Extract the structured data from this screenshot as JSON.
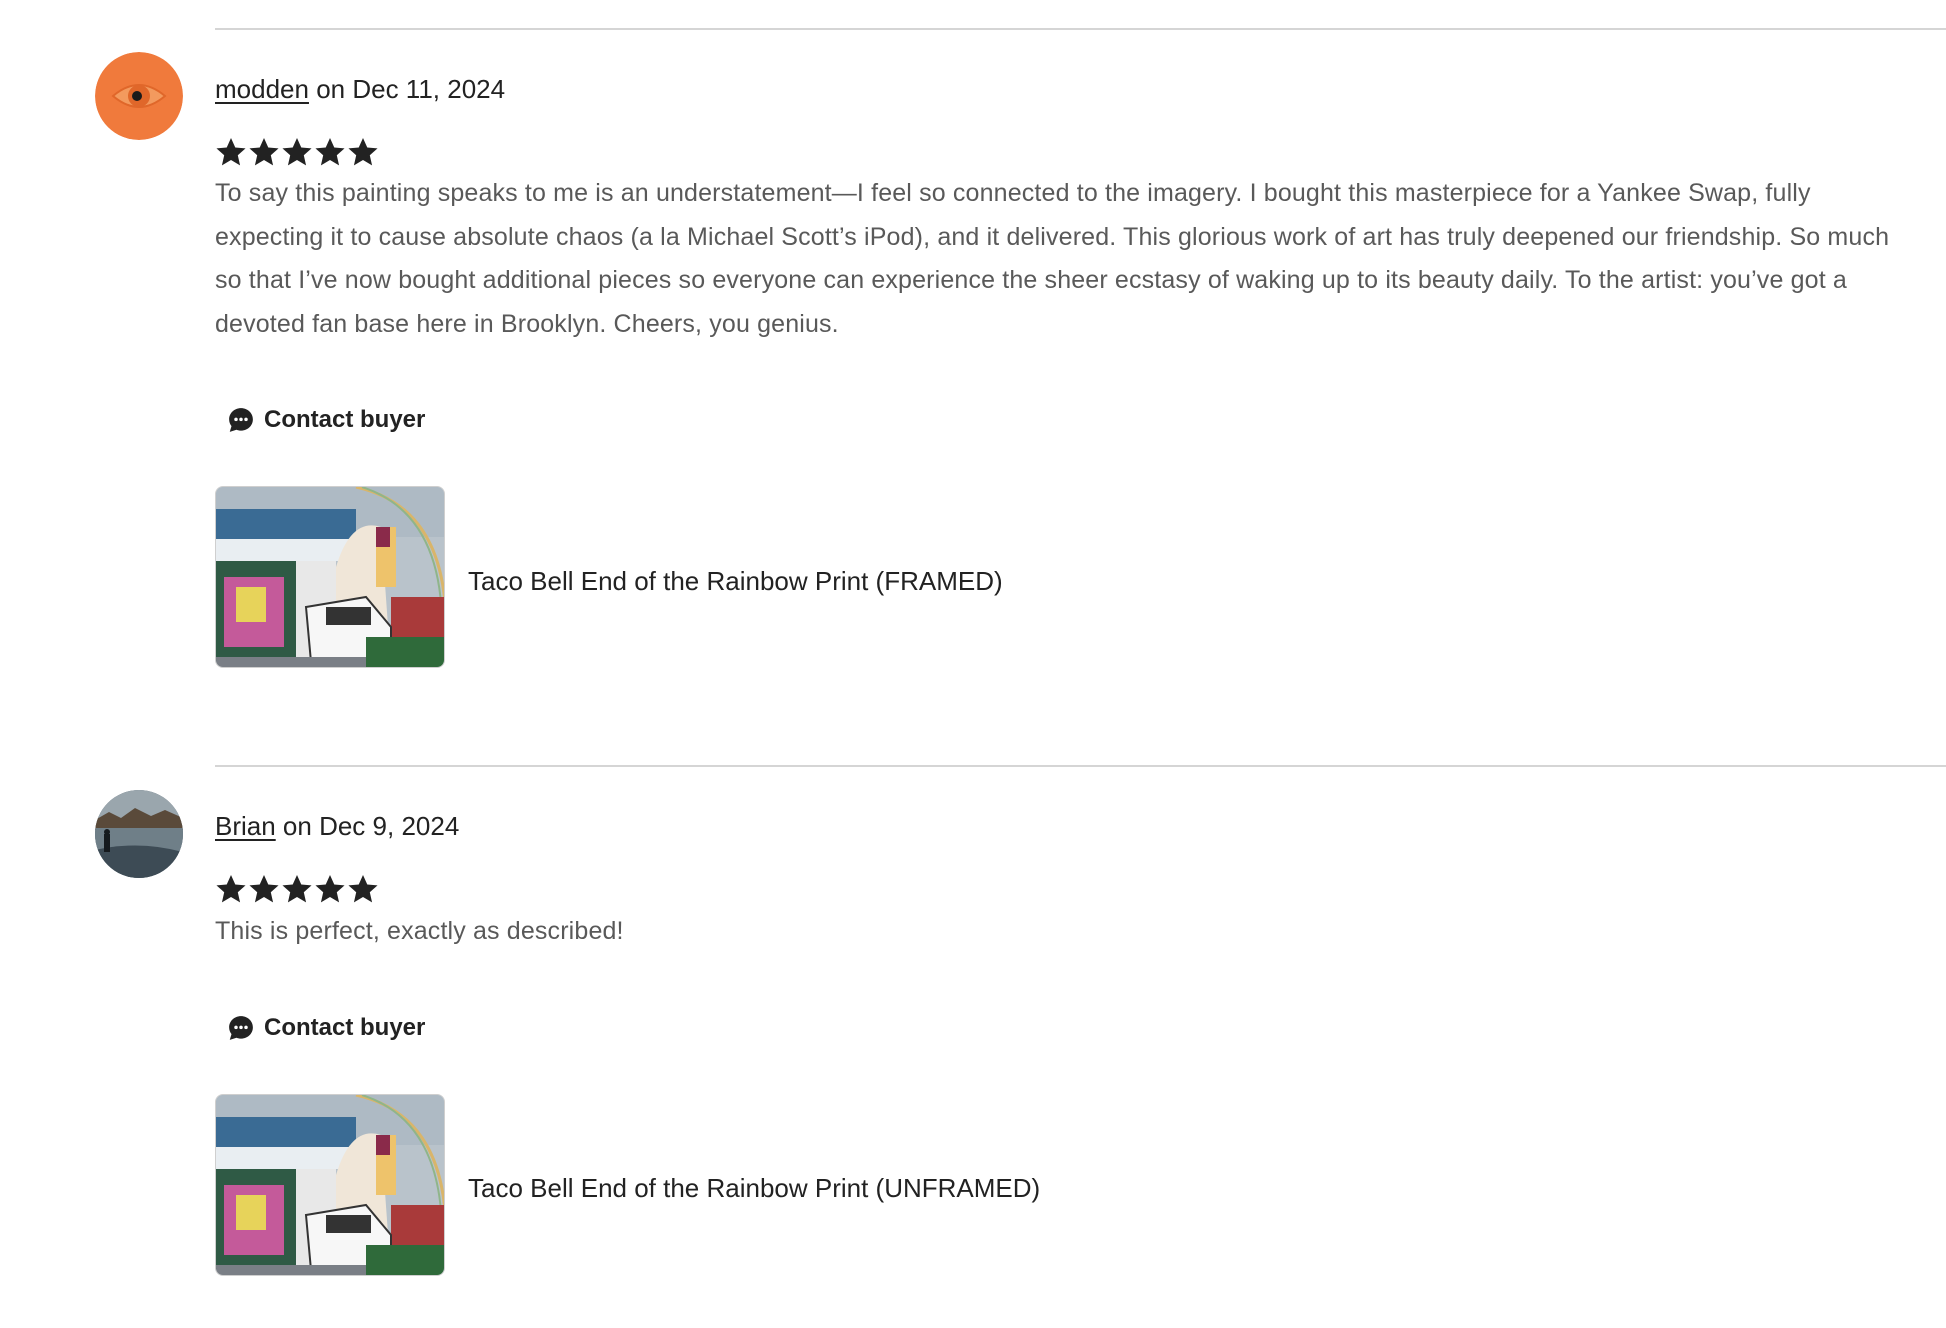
{
  "reviews": [
    {
      "username": "modden",
      "date_text": " on Dec 11, 2024",
      "rating": 5,
      "text": "To say this painting speaks to me is an understatement—I feel so connected to the imagery. I bought this masterpiece for a Yankee Swap, fully expecting it to cause absolute chaos (a la Michael Scott’s iPod), and it delivered. This glorious work of art has truly deepened our friendship. So much so that I’ve now bought additional pieces so everyone can experience the sheer ecstasy of waking up to its beauty daily. To the artist: you’ve got a devoted fan base here in Brooklyn. Cheers, you genius.",
      "contact_label": "Contact buyer",
      "product_title": "Taco Bell End of the Rainbow Print (FRAMED)",
      "avatar_icon": "eye-avatar",
      "avatar_color": "#f07a3c"
    },
    {
      "username": "Brian",
      "date_text": " on Dec 9, 2024",
      "rating": 5,
      "text": "This is perfect, exactly as described!",
      "contact_label": "Contact buyer",
      "product_title": "Taco Bell End of the Rainbow Print (UNFRAMED)",
      "avatar_icon": "photo-avatar",
      "avatar_color": "#4a5a66"
    }
  ],
  "icons": {
    "star": "star-icon",
    "contact": "chat-bubble-icon"
  },
  "colors": {
    "text_primary": "#222222",
    "text_secondary": "#595959",
    "divider": "#d5d5d5"
  }
}
